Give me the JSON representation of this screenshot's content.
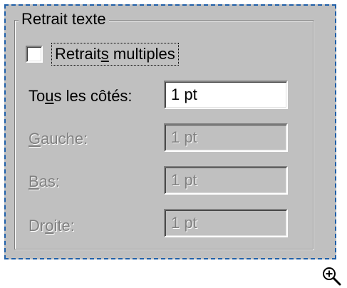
{
  "group": {
    "title": "Retrait texte"
  },
  "multiple_indents": {
    "label_before": "Retrait",
    "label_underline": "s",
    "label_after": " multiples",
    "checked": false
  },
  "rows": {
    "all_sides": {
      "label_before": "To",
      "label_underline": "u",
      "label_after": "s les côtés:",
      "value": "1 pt",
      "enabled": true
    },
    "left": {
      "label_before": "",
      "label_underline": "G",
      "label_after": "auche:",
      "value": "1 pt",
      "enabled": false
    },
    "bottom": {
      "label_before": "",
      "label_underline": "B",
      "label_after": "as:",
      "value": "1 pt",
      "enabled": false
    },
    "right": {
      "label_before": "Dr",
      "label_underline": "o",
      "label_after": "ite:",
      "value": "1 pt",
      "enabled": false
    }
  },
  "icons": {
    "zoom": "zoom-in-magnifier-icon"
  },
  "colors": {
    "surface": "#c0c0c0",
    "dashed_border": "#1f5fa8",
    "disabled_text": "#808080"
  }
}
